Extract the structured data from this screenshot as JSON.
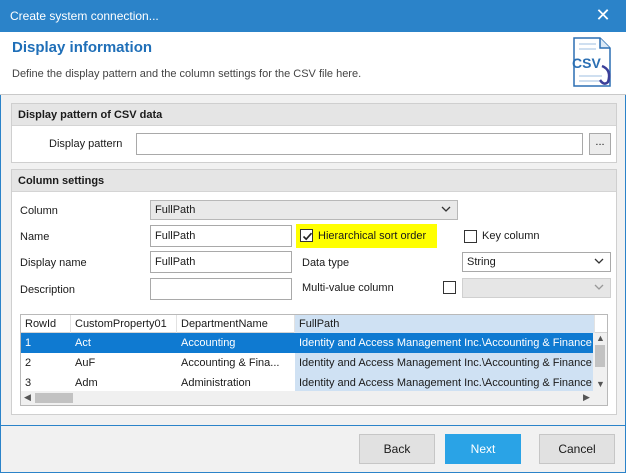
{
  "window": {
    "title": "Create system connection..."
  },
  "header": {
    "title": "Display information",
    "description": "Define the display pattern and the column settings for the CSV file here.",
    "icon_text": "CSV"
  },
  "display_pattern": {
    "section_title": "Display pattern of CSV data",
    "label": "Display pattern",
    "value": "",
    "browse_label": "..."
  },
  "column_settings": {
    "section_title": "Column settings",
    "column_label": "Column",
    "column_value": "FullPath",
    "name_label": "Name",
    "name_value": "FullPath",
    "display_name_label": "Display name",
    "display_name_value": "FullPath",
    "description_label": "Description",
    "description_value": "",
    "hierarchical_sort_label": "Hierarchical sort order",
    "hierarchical_sort_checked": true,
    "key_column_label": "Key column",
    "key_column_checked": false,
    "data_type_label": "Data type",
    "data_type_value": "String",
    "multi_value_label": "Multi-value column",
    "multi_value_checked": false,
    "multi_value_select": ""
  },
  "grid": {
    "columns": [
      "RowId",
      "CustomProperty01",
      "DepartmentName",
      "FullPath"
    ],
    "rows": [
      [
        "1",
        "Act",
        "Accounting",
        "Identity and Access Management Inc.\\Accounting & Finance"
      ],
      [
        "2",
        "AuF",
        "Accounting & Fina...",
        "Identity and Access Management Inc.\\Accounting & Finance"
      ],
      [
        "3",
        "Adm",
        "Administration",
        "Identity and Access Management Inc.\\Accounting & Finance"
      ]
    ]
  },
  "footer": {
    "back": "Back",
    "next": "Next",
    "cancel": "Cancel"
  },
  "colors": {
    "accent": "#2b83c9",
    "primary_button": "#2aa3e6",
    "selected_row": "#0f7ad1",
    "highlight": "#ffff00"
  },
  "icons": [
    "close-icon",
    "csv-file-icon",
    "chevron-down-icon",
    "checkmark-icon"
  ]
}
